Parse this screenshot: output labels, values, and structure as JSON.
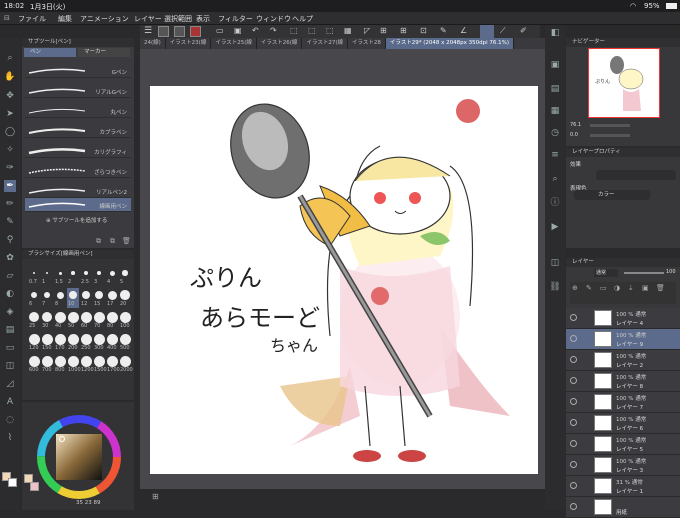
{
  "status": {
    "time": "18:02",
    "date": "1月3日(火)",
    "battery": "95%"
  },
  "menu": [
    "ファイル",
    "編集",
    "アニメーション",
    "レイヤー",
    "選択範囲",
    "表示",
    "フィルター",
    "ウィンドウ",
    "ヘルプ"
  ],
  "tabs": [
    "24(線)",
    "イラスト23(線",
    "イラスト25(線",
    "イラスト26(線",
    "イラスト27(線",
    "イラスト28",
    "イラスト29* (2048 x 2048px 350dpi 76.1%)"
  ],
  "subtool": {
    "title": "サブツール[ペン]",
    "tab1": "ペン",
    "tab2": "マーカー",
    "items": [
      "Gペン",
      "リアルGペン",
      "丸ペン",
      "カブラペン",
      "カリグラフィ",
      "ざらつきペン",
      "リアルペン2",
      "線画用ペン"
    ],
    "add": "サブツールを追加する"
  },
  "brushsize": {
    "title": "ブラシサイズ[線画用ペン]",
    "sizes": [
      "0.7",
      "1",
      "1.5",
      "2",
      "2.5",
      "3",
      "4",
      "5",
      "6",
      "7",
      "8",
      "10",
      "12",
      "15",
      "17",
      "20",
      "25",
      "30",
      "40",
      "50",
      "60",
      "70",
      "80",
      "100",
      "120",
      "150",
      "170",
      "200",
      "250",
      "300",
      "400",
      "500",
      "600",
      "700",
      "800",
      "1000",
      "1200",
      "1500",
      "1700",
      "2000"
    ]
  },
  "color": {
    "readout": "35  23  89"
  },
  "navigator": {
    "title": "ナビゲーター",
    "zoom": "76.1",
    "angle": "0.0"
  },
  "layerprop": {
    "title": "レイヤープロパティ",
    "effect": "効果",
    "expr": "表現色",
    "color_mode": "カラー"
  },
  "layers": {
    "title": "レイヤー",
    "blend": "通常",
    "opacity": "100",
    "rows": [
      {
        "mode": "100 % 通常",
        "name": "レイヤー 4"
      },
      {
        "mode": "100 % 通常",
        "name": "レイヤー 9"
      },
      {
        "mode": "100 % 通常",
        "name": "レイヤー 2"
      },
      {
        "mode": "100 % 通常",
        "name": "レイヤー 8"
      },
      {
        "mode": "100 % 通常",
        "name": "レイヤー 7"
      },
      {
        "mode": "100 % 通常",
        "name": "レイヤー 6"
      },
      {
        "mode": "100 % 通常",
        "name": "レイヤー 5"
      },
      {
        "mode": "100 % 通常",
        "name": "レイヤー 3"
      },
      {
        "mode": "31 % 通常",
        "name": "レイヤー 1"
      },
      {
        "mode": "",
        "name": "用紙"
      }
    ]
  },
  "canvas": {
    "text1": "ぷりん",
    "text2": "あらモーど",
    "text3": "ちゃん"
  }
}
